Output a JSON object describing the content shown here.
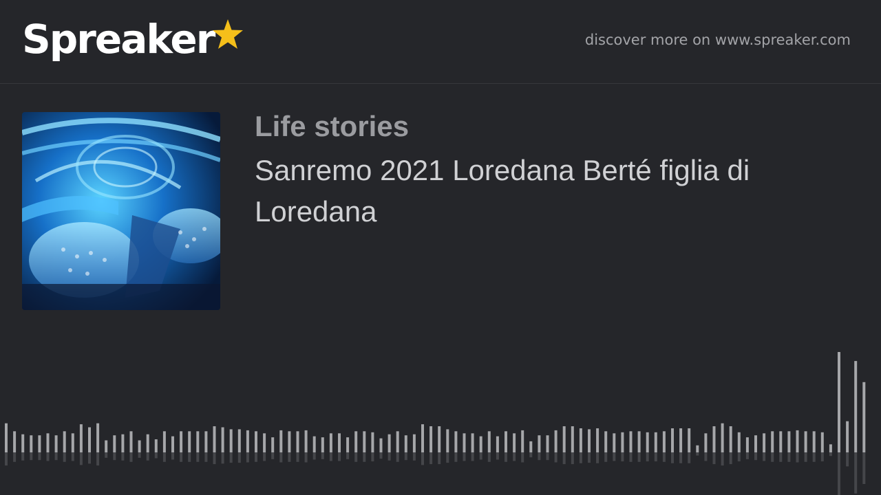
{
  "header": {
    "logo_text": "Spreaker",
    "logo_icon": "star-icon",
    "discover_text": "discover more on www.spreaker.com"
  },
  "episode": {
    "cover_image": "stage-concert-cover",
    "show_title": "Life stories",
    "title": "Sanremo 2021 Loredana Berté  figlia di Loredana"
  },
  "waveform": {
    "icon": "audio-waveform",
    "levels": [
      0.29,
      0.21,
      0.18,
      0.17,
      0.17,
      0.19,
      0.17,
      0.21,
      0.19,
      0.28,
      0.25,
      0.29,
      0.12,
      0.17,
      0.18,
      0.21,
      0.12,
      0.18,
      0.13,
      0.21,
      0.16,
      0.21,
      0.21,
      0.21,
      0.21,
      0.26,
      0.25,
      0.23,
      0.23,
      0.22,
      0.21,
      0.19,
      0.15,
      0.22,
      0.21,
      0.21,
      0.22,
      0.16,
      0.15,
      0.19,
      0.19,
      0.15,
      0.21,
      0.21,
      0.2,
      0.14,
      0.18,
      0.21,
      0.17,
      0.18,
      0.28,
      0.26,
      0.26,
      0.23,
      0.21,
      0.19,
      0.19,
      0.16,
      0.21,
      0.16,
      0.21,
      0.19,
      0.22,
      0.11,
      0.17,
      0.17,
      0.22,
      0.26,
      0.26,
      0.24,
      0.23,
      0.24,
      0.21,
      0.19,
      0.2,
      0.21,
      0.21,
      0.2,
      0.2,
      0.21,
      0.24,
      0.24,
      0.24,
      0.07,
      0.19,
      0.26,
      0.29,
      0.26,
      0.2,
      0.15,
      0.17,
      0.19,
      0.21,
      0.21,
      0.21,
      0.22,
      0.21,
      0.21,
      0.2,
      0.08,
      1.0,
      0.31,
      0.91,
      0.7
    ],
    "bar_color": "#a6a7aa",
    "bg_color": "#25262a"
  },
  "colors": {
    "background": "#25262a",
    "accent": "#f5bf1a",
    "text_primary": "#d0d1d4",
    "text_secondary": "#9b9ca0"
  }
}
